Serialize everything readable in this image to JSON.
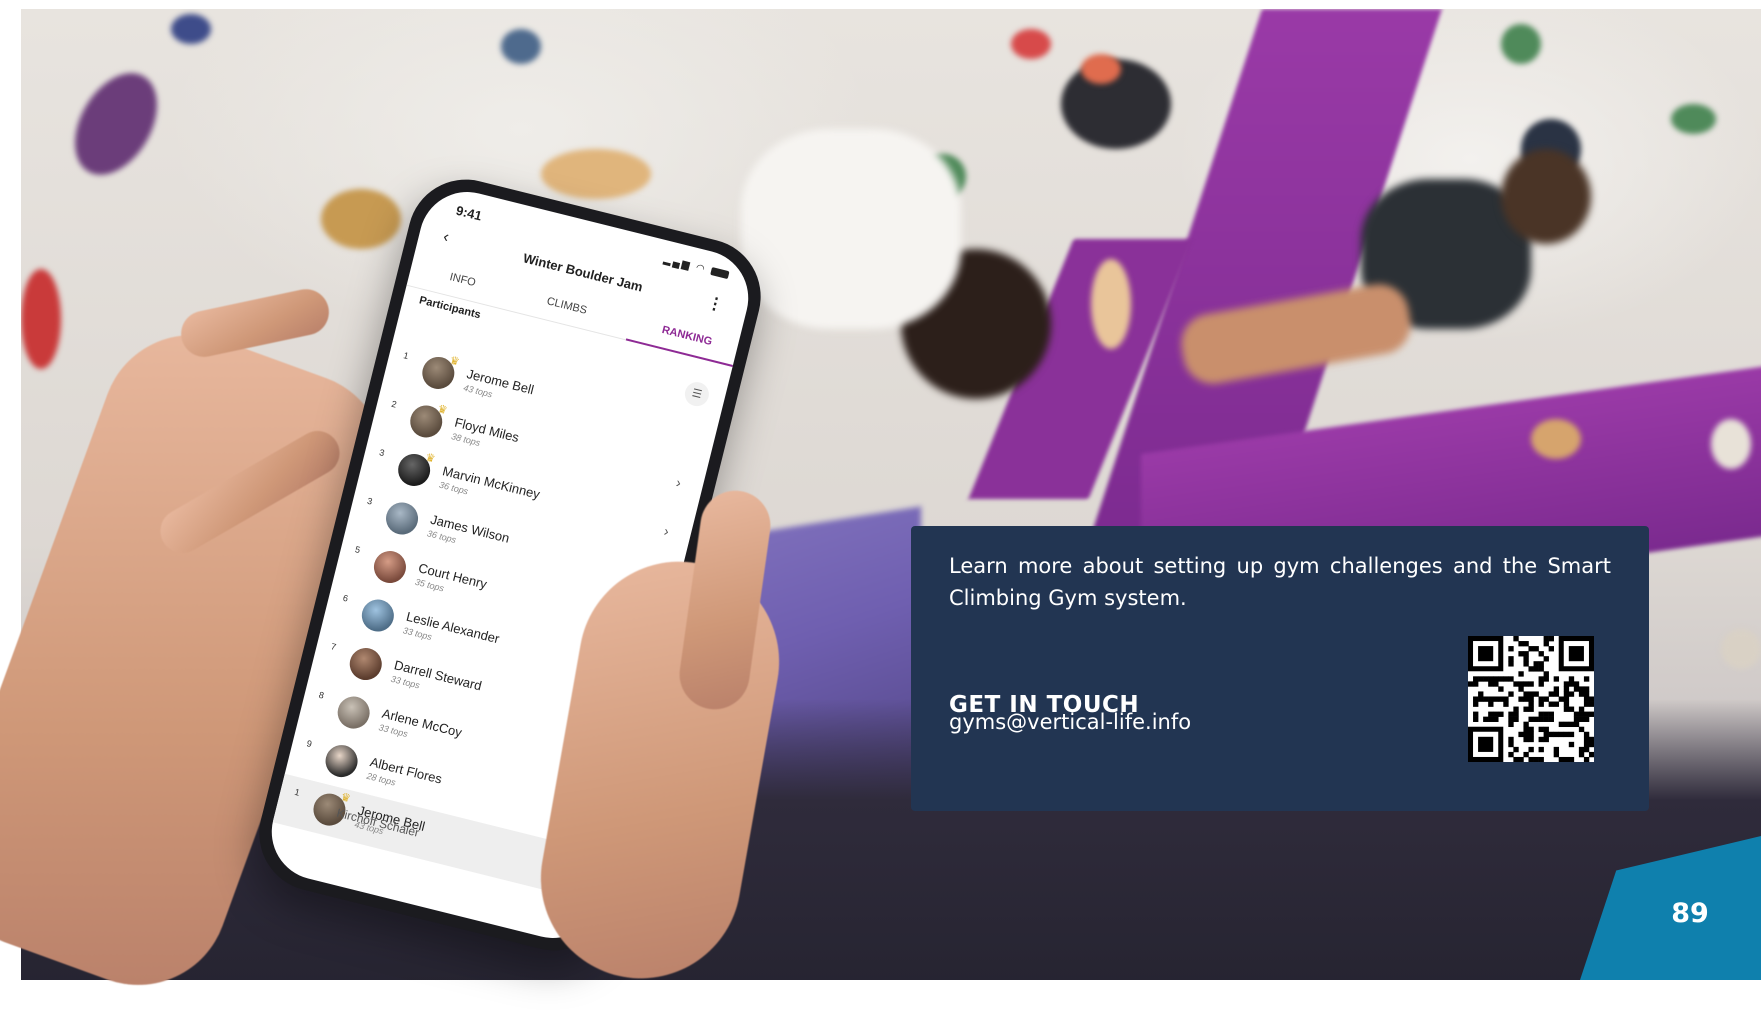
{
  "phone": {
    "status_time": "9:41",
    "event_title": "Winter Boulder Jam",
    "tabs": [
      {
        "label": "INFO",
        "active": false
      },
      {
        "label": "CLIMBS",
        "active": false
      },
      {
        "label": "RANKING",
        "active": true
      }
    ],
    "list_heading": "Participants",
    "ranking": [
      {
        "rank": "1",
        "name": "Jerome Bell",
        "tops": "43 tops",
        "crown": true
      },
      {
        "rank": "2",
        "name": "Floyd Miles",
        "tops": "38 tops",
        "crown": true
      },
      {
        "rank": "3",
        "name": "Marvin McKinney",
        "tops": "36 tops",
        "crown": true
      },
      {
        "rank": "3",
        "name": "James Wilson",
        "tops": "36 tops",
        "crown": false
      },
      {
        "rank": "5",
        "name": "Court Henry",
        "tops": "35 tops",
        "crown": false
      },
      {
        "rank": "6",
        "name": "Leslie Alexander",
        "tops": "33 tops",
        "crown": false
      },
      {
        "rank": "7",
        "name": "Darrell Steward",
        "tops": "33 tops",
        "crown": false
      },
      {
        "rank": "8",
        "name": "Arlene McCoy",
        "tops": "33 tops",
        "crown": false
      },
      {
        "rank": "9",
        "name": "Albert Flores",
        "tops": "28 tops",
        "crown": false
      },
      {
        "rank": "1",
        "name": "Jerome Bell",
        "tops": "43 tops",
        "crown": true
      }
    ],
    "cutoff_row": "Kirchoff Schaler",
    "accent_color": "#8e2a95"
  },
  "card": {
    "description": "Learn more about setting up gym challenges and the Smart Climbing Gym system.",
    "cta": "GET IN TOUCH",
    "email": "gyms@vertical-life.info",
    "background_color": "#223552"
  },
  "page_number": "89",
  "corner_color": "#0f80ad"
}
